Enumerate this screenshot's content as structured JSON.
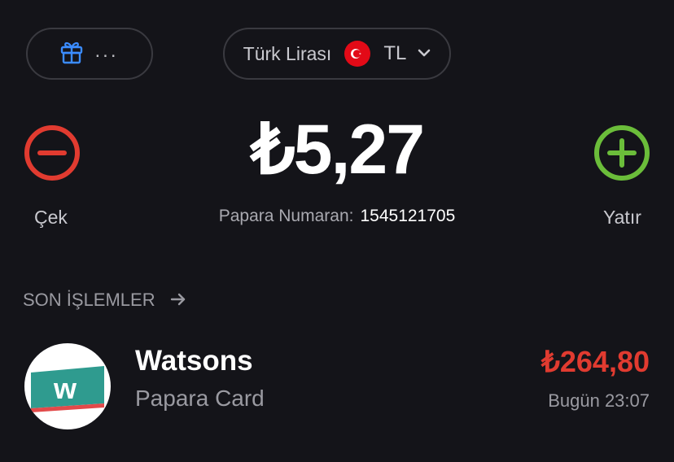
{
  "gift": {
    "dots": "...",
    "icon": "gift-icon"
  },
  "currency": {
    "name": "Türk Lirası",
    "code": "TL",
    "flag": "turkey-flag-icon"
  },
  "balance": {
    "amount": "₺5,27"
  },
  "papara_number": {
    "label": "Papara Numaran:",
    "value": "1545121705"
  },
  "actions": {
    "withdraw": {
      "label": "Çek",
      "color": "#e13b30"
    },
    "deposit": {
      "label": "Yatır",
      "color": "#6bbd3a"
    }
  },
  "recent": {
    "title": "SON İŞLEMLER",
    "transactions": [
      {
        "merchant": "Watsons",
        "source": "Papara Card",
        "amount": "₺264,80",
        "time": "Bugün 23:07",
        "logo_letter": "w"
      }
    ]
  }
}
